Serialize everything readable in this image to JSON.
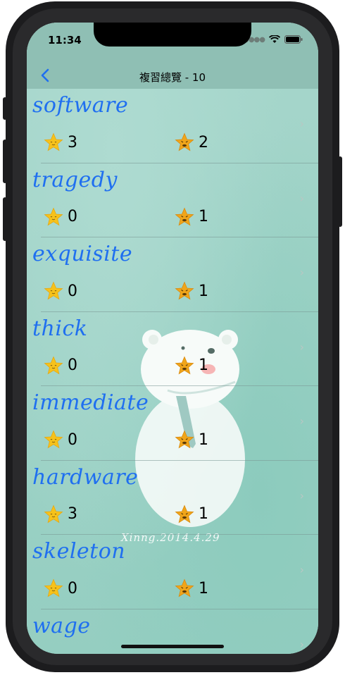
{
  "status_bar": {
    "time": "11:34"
  },
  "nav": {
    "back_icon": "chevron-left-icon",
    "title": "複習總覽 - 10"
  },
  "colors": {
    "accent": "#1f6ff0",
    "background": "#9fd1c6",
    "star": "#f6c21b"
  },
  "watermark": {
    "signature": "Xinng.2014.4.29"
  },
  "words": [
    {
      "word": "software",
      "good": "3",
      "bad": "2"
    },
    {
      "word": "tragedy",
      "good": "0",
      "bad": "1"
    },
    {
      "word": "exquisite",
      "good": "0",
      "bad": "1"
    },
    {
      "word": "thick",
      "good": "0",
      "bad": "1"
    },
    {
      "word": "immediate",
      "good": "0",
      "bad": "1"
    },
    {
      "word": "hardware",
      "good": "3",
      "bad": "1"
    },
    {
      "word": "skeleton",
      "good": "0",
      "bad": "1"
    },
    {
      "word": "wage",
      "good": "",
      "bad": ""
    }
  ]
}
